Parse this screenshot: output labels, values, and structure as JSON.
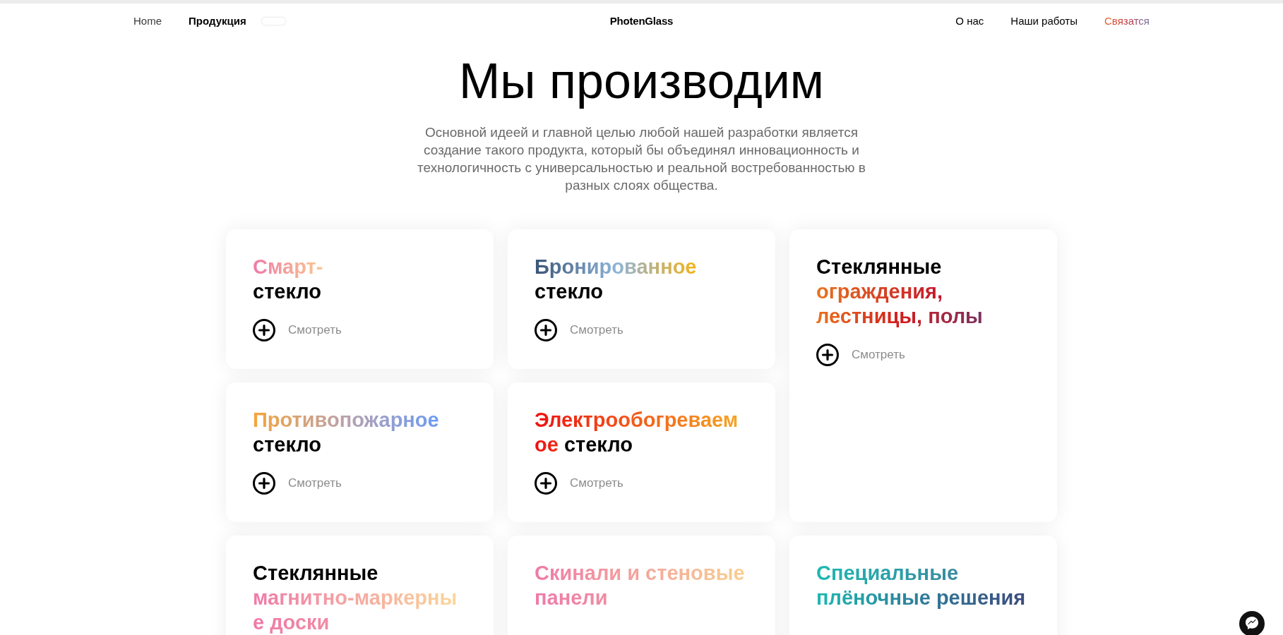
{
  "nav": {
    "left": [
      {
        "label": "Home",
        "selected": false
      },
      {
        "label": "Продукция",
        "selected": true
      }
    ],
    "logo": "PhotenGlass",
    "right": [
      {
        "label": "О нас",
        "kind": "plain"
      },
      {
        "label": "Наши работы",
        "kind": "plain"
      },
      {
        "label": "Связатся",
        "kind": "gradient"
      }
    ]
  },
  "heading": "Мы производим",
  "intro": "Основной идеей и главной целью любой нашей разработки является создание такого продукта, который бы объединял инновационность и технологичность с универсальностью и реальной востребованностью в разных слоях общества.",
  "cards": [
    {
      "kind": "regular",
      "title_lines": [
        [
          {
            "text": "Смарт-",
            "kind": "gradient"
          }
        ],
        [
          {
            "text": "стекло",
            "kind": "plain"
          }
        ]
      ],
      "link": "Смотреть"
    },
    {
      "kind": "regular",
      "title_lines": [
        [
          {
            "text": "Бронированное",
            "kind": "gradient"
          }
        ],
        [
          {
            "text": "стекло",
            "kind": "plain"
          }
        ]
      ],
      "link": "Смотреть"
    },
    {
      "kind": "tall",
      "title_lines": [
        [
          {
            "text": "Стеклянные",
            "kind": "plain"
          }
        ],
        [
          {
            "text": "ограждения,",
            "kind": "gradient"
          }
        ],
        [
          {
            "text": "лестницы, полы",
            "kind": "gradient"
          }
        ]
      ],
      "link": "Смотреть"
    },
    {
      "kind": "regular",
      "title_lines": [
        [
          {
            "text": "Противопожарное",
            "kind": "gradient"
          }
        ],
        [
          {
            "text": "стекло",
            "kind": "plain"
          }
        ]
      ],
      "link": "Смотреть"
    },
    {
      "kind": "regular",
      "title_lines": [
        [
          {
            "text": "Электрообогреваем",
            "kind": "gradient"
          }
        ],
        [
          {
            "text": "ое",
            "kind": "gradient"
          },
          {
            "text": " стекло",
            "kind": "plain"
          }
        ]
      ],
      "link": "Смотреть"
    },
    {
      "kind": "regular",
      "title_lines": [
        [
          {
            "text": "Стеклянные",
            "kind": "plain"
          }
        ],
        [
          {
            "text": "магнитно-маркерны",
            "kind": "gradient"
          }
        ],
        [
          {
            "text": "е доски",
            "kind": "gradient"
          }
        ]
      ]
    },
    {
      "kind": "regular",
      "title_lines": [
        [
          {
            "text": "Скинали и стеновые",
            "kind": "gradient"
          }
        ],
        [
          {
            "text": "панели",
            "kind": "gradient"
          }
        ]
      ]
    },
    {
      "kind": "regular",
      "title_lines": [
        [
          {
            "text": "Специальные",
            "kind": "gradient"
          }
        ],
        [
          {
            "text": "плёночные решения",
            "kind": "gradient"
          }
        ]
      ]
    }
  ]
}
